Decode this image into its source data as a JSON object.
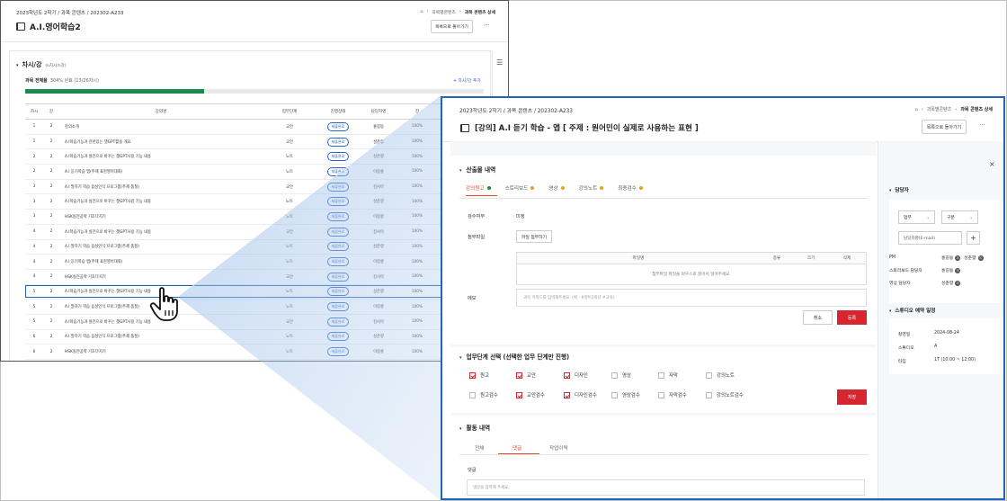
{
  "back_window": {
    "breadcrumb": "2023학년도 2학기 / 과목 콘텐츠 / 202302-A233",
    "nav": [
      "과목별콘텐츠",
      "과목 콘텐츠 상세"
    ],
    "title": "A.I.영어학습2",
    "back_button": "목록으로 돌아가기",
    "more": "···",
    "section_title": "차시/강",
    "section_count": "(n차시/n강)",
    "progress_label": "과목 전체율",
    "progress_text": "304% 완료 (13/26차시)",
    "progress_fraction": 0.39,
    "add_label": "+ 차시/강 추가",
    "columns": [
      "차시",
      "강",
      "강의명",
      "업무단계",
      "진행상태",
      "담당자명",
      "진"
    ],
    "rows": [
      {
        "chasi": "1",
        "gang": "2",
        "name": "강의소개",
        "stage": "교안",
        "status": "제출완료",
        "owner": "홍길동",
        "pct": "100%"
      },
      {
        "chasi": "1",
        "gang": "2",
        "name": "A.I학습기능과 관련있는 챗GPT활용 개요",
        "stage": "교안",
        "status": "제출완료",
        "owner": "성춘향",
        "pct": "100%"
      },
      {
        "chasi": "2",
        "gang": "2",
        "name": "A.I학습기능과 실전으로 바꾸는 챗GPT사용 기능 내용",
        "stage": "노트",
        "status": "제출완료",
        "owner": "성춘향",
        "pct": "100%"
      },
      {
        "chasi": "2",
        "gang": "2",
        "name": "A.I 듣기학습 앱(주제 표현영어대화)",
        "stage": "노트",
        "status": "제출완료",
        "owner": "이몽룡",
        "pct": "100%"
      },
      {
        "chasi": "3",
        "gang": "2",
        "name": "A.I 말하기 학습 음성인식 프로그램(주제 품질)",
        "stage": "교안",
        "status": "제출완료",
        "owner": "김서아",
        "pct": "100%"
      },
      {
        "chasi": "3",
        "gang": "2",
        "name": "A.I학습기능과 실전으로 바꾸는 챗GPT사용 기능 내용",
        "stage": "노트",
        "status": "제출완료",
        "owner": "성춘향",
        "pct": "100%"
      },
      {
        "chasi": "3",
        "gang": "2",
        "name": "HSK실전공략 기초다지기",
        "stage": "노트",
        "status": "제출완료",
        "owner": "이몽룡",
        "pct": "100%"
      },
      {
        "chasi": "4",
        "gang": "2",
        "name": "A.I학습기능과 실전으로 바꾸는 챗GPT사용 기능 내용",
        "stage": "교안",
        "status": "제출완료",
        "owner": "김서아",
        "pct": "100%"
      },
      {
        "chasi": "4",
        "gang": "2",
        "name": "A.I 말하기 학습 음성인식 프로그램(주제 품질)",
        "stage": "노트",
        "status": "제출완료",
        "owner": "성춘향",
        "pct": "100%"
      },
      {
        "chasi": "4",
        "gang": "2",
        "name": "A.I 듣기학습 앱(주제 표현영어대화)",
        "stage": "노트",
        "status": "제출완료",
        "owner": "이몽룡",
        "pct": "100%"
      },
      {
        "chasi": "4",
        "gang": "2",
        "name": "HSK실전공략 기초다지기",
        "stage": "교안",
        "status": "제출완료",
        "owner": "김서아",
        "pct": "100%"
      },
      {
        "chasi": "5",
        "gang": "2",
        "name": "A.I학습기능과 실전으로 바꾸는 챗GPT사용 기능 내용",
        "stage": "노트",
        "status": "제출완료",
        "owner": "성춘향",
        "pct": "100%"
      },
      {
        "chasi": "5",
        "gang": "2",
        "name": "A.I 말하기 학습 음성인식 프로그램(주제 품질)",
        "stage": "노트",
        "status": "제출완료",
        "owner": "이몽룡",
        "pct": "100%"
      },
      {
        "chasi": "5",
        "gang": "2",
        "name": "A.I학습기능과 실전으로 바꾸는 챗GPT사용 기능 내용",
        "stage": "교안",
        "status": "제출완료",
        "owner": "김서아",
        "pct": "100%"
      },
      {
        "chasi": "6",
        "gang": "2",
        "name": "A.I 말하기 학습 음성인식 프로그램(주제 품질)",
        "stage": "노트",
        "status": "제출완료",
        "owner": "성춘향",
        "pct": "100%"
      },
      {
        "chasi": "6",
        "gang": "2",
        "name": "HSK실전공략 기초다지기",
        "stage": "노트",
        "status": "제출완료",
        "owner": "이몽룡",
        "pct": "100%"
      }
    ]
  },
  "front_window": {
    "breadcrumb": "2023학년도 2학기 / 과목 콘텐츠 / 202302-A233",
    "nav": [
      "과목별콘텐츠",
      "과목 콘텐츠 상세"
    ],
    "title": "[강의] A.I 듣기 학습 - 앱 [ 주제 : 원어민이 실제로 사용하는 표현 ]",
    "back_button": "목록으로 돌아가기",
    "more": "···",
    "output_section": {
      "heading": "산출물 내역",
      "tabs": [
        {
          "label": "강의원고",
          "dot": "#1b8a4a"
        },
        {
          "label": "스토리보드",
          "dot": "#e8a31d"
        },
        {
          "label": "영상",
          "dot": "#e8a31d"
        },
        {
          "label": "강의노트",
          "dot": "#e8a31d"
        },
        {
          "label": "최종검수",
          "dot": "#e8a31d"
        }
      ],
      "review_label": "검수여부",
      "review_value": "미정",
      "attach_label": "첨부파일",
      "attach_button": "파일 첨부하기",
      "file_columns": [
        "파일명",
        "종류",
        "크기",
        "삭제"
      ],
      "file_empty": "첨부파일 파일을 마우스로 끌어서 넣어주세요.",
      "memo_label": "메모",
      "memo_placeholder": "과목 키워드를 입력해주세요. (예 : #영어1학년 #교육)",
      "cancel": "취소",
      "register": "등록"
    },
    "stage_section": {
      "heading": "업무단계 선택 (선택한 업무 단계만 진행)",
      "row1": [
        {
          "label": "원고",
          "checked": true
        },
        {
          "label": "교안",
          "checked": true
        },
        {
          "label": "디자인",
          "checked": true
        },
        {
          "label": "영상",
          "checked": false
        },
        {
          "label": "자막",
          "checked": false
        },
        {
          "label": "강의노트",
          "checked": false
        }
      ],
      "row2": [
        {
          "label": "원고검수",
          "checked": false
        },
        {
          "label": "교안검수",
          "checked": true
        },
        {
          "label": "디자인검수",
          "checked": true
        },
        {
          "label": "영상검수",
          "checked": false
        },
        {
          "label": "자막검수",
          "checked": false
        },
        {
          "label": "강의노트검수",
          "checked": false
        }
      ],
      "save": "저장"
    },
    "activity_section": {
      "heading": "활동 내역",
      "tabs": [
        "전체",
        "댓글",
        "작업이력"
      ],
      "comment_label": "댓글",
      "comment_placeholder": "댓글을 입력해 주세요."
    },
    "side": {
      "close": "×",
      "manager_heading": "담당자",
      "select1": "업무",
      "select2": "구분",
      "manager_input": "담당자명(E-mail)",
      "plus": "+",
      "managers": [
        {
          "role": "PM",
          "names": [
            "홍길동",
            "성춘향"
          ]
        },
        {
          "role": "스토리보드 담당자",
          "names": [
            "홍길동"
          ]
        },
        {
          "role": "영상 담당자",
          "names": [
            "성춘향"
          ]
        }
      ],
      "studio_heading": "스튜디오 예약 일정",
      "studio": [
        {
          "key": "촬영일",
          "value": "2024-08-24"
        },
        {
          "key": "스튜디오",
          "value": "A"
        },
        {
          "key": "타임",
          "value": "1T (10:00 ~ 12:00)"
        }
      ]
    }
  }
}
